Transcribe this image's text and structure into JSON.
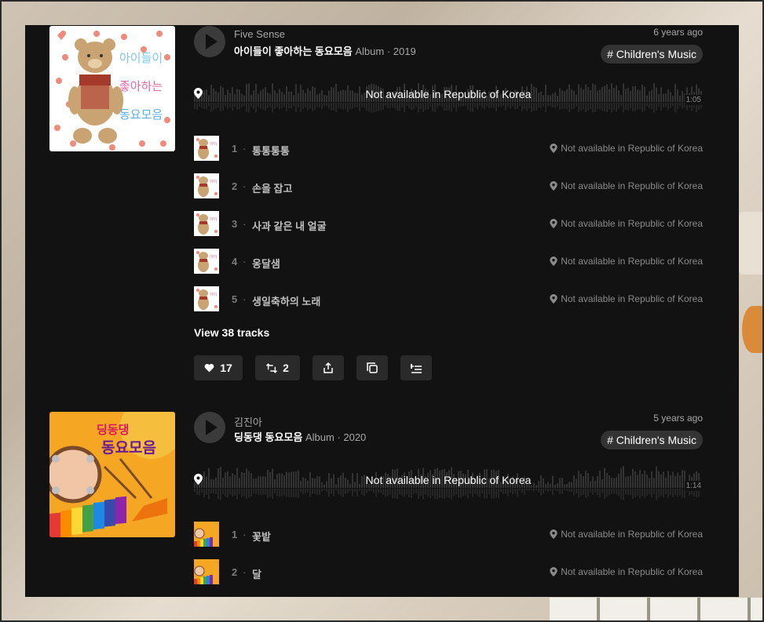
{
  "albums": [
    {
      "artist": "Five Sense",
      "title": "아이들이 좋아하는 동요모음",
      "meta": "Album · 2019",
      "age": "6 years ago",
      "tag": "# Children's Music",
      "availability": "Not available in Republic of Korea",
      "duration": "1:05",
      "cover_text": [
        "아이들이",
        "좋아하는",
        "동요모음"
      ],
      "tracks": [
        {
          "num": "1",
          "name": "통통통통",
          "status": "Not available in Republic of Korea"
        },
        {
          "num": "2",
          "name": "손을 잡고",
          "status": "Not available in Republic of Korea"
        },
        {
          "num": "3",
          "name": "사과 같은 내 얼굴",
          "status": "Not available in Republic of Korea"
        },
        {
          "num": "4",
          "name": "옹달샘",
          "status": "Not available in Republic of Korea"
        },
        {
          "num": "5",
          "name": "생일축하의 노래",
          "status": "Not available in Republic of Korea"
        }
      ],
      "view_tracks": "View 38 tracks",
      "actions": {
        "likes": "17",
        "reposts": "2"
      }
    },
    {
      "artist": "김진아",
      "title": "딩동댕 동요모음",
      "meta": "Album · 2020",
      "age": "5 years ago",
      "tag": "# Children's Music",
      "availability": "Not available in Republic of Korea",
      "duration": "1:14",
      "cover_text": [
        "딩동댕",
        "동요모음"
      ],
      "tracks": [
        {
          "num": "1",
          "name": "꽃밭",
          "status": "Not available in Republic of Korea"
        },
        {
          "num": "2",
          "name": "달",
          "status": "Not available in Republic of Korea"
        }
      ]
    }
  ],
  "icons": {
    "play": "play-icon",
    "pin": "map-pin-icon",
    "like": "heart-icon",
    "repost": "repost-icon",
    "share": "share-icon",
    "copy": "copy-icon",
    "queue": "add-to-queue-icon"
  },
  "colors": {
    "panel_bg": "#121212",
    "button_bg": "#2a2a2a",
    "tag_bg": "#333333",
    "muted_text": "#a7a7a7"
  }
}
